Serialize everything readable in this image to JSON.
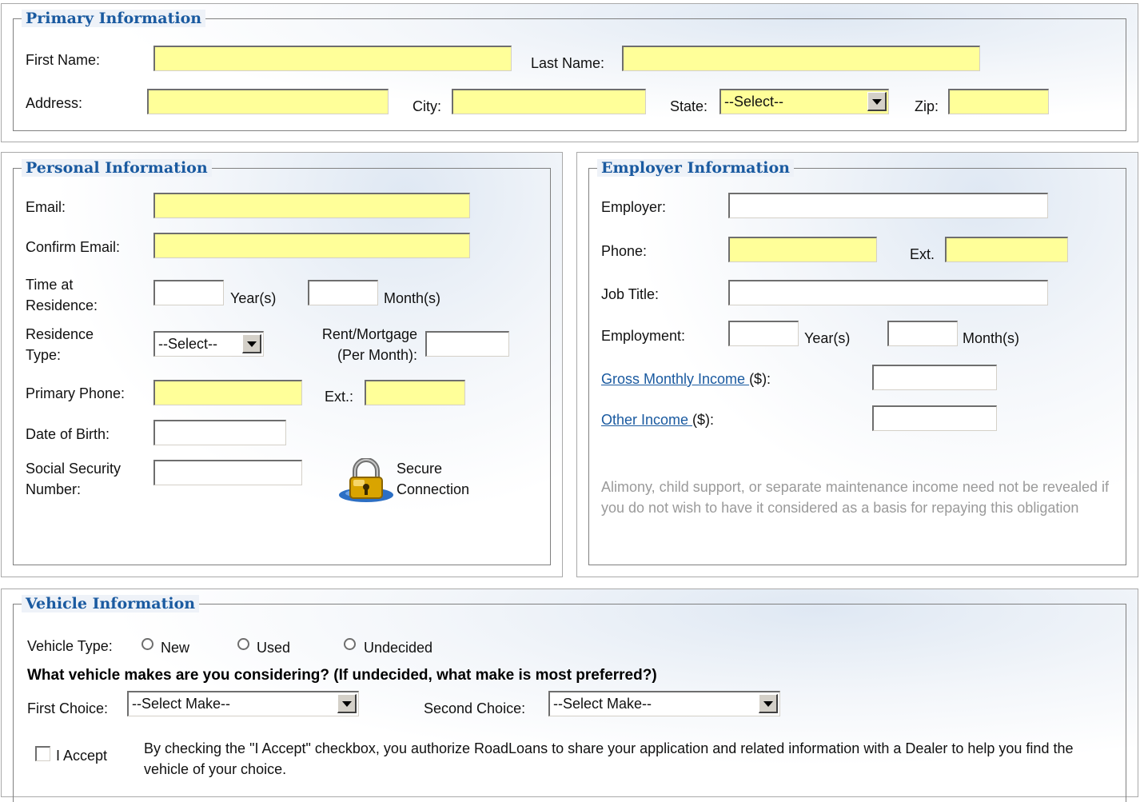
{
  "primary": {
    "legend": "Primary Information",
    "first_name_label": "First Name:",
    "last_name_label": "Last Name:",
    "address_label": "Address:",
    "city_label": "City:",
    "state_label": "State:",
    "state_value": "--Select--",
    "zip_label": "Zip:"
  },
  "personal": {
    "legend": "Personal Information",
    "email_label": "Email:",
    "confirm_email_label": "Confirm Email:",
    "time_at_residence_label_1": "Time at",
    "time_at_residence_label_2": "Residence:",
    "years_label": "Year(s)",
    "months_label": "Month(s)",
    "residence_type_label_1": "Residence",
    "residence_type_label_2": "Type:",
    "residence_type_value": "--Select--",
    "rent_label_1": "Rent/Mortgage",
    "rent_label_2": "(Per Month):",
    "primary_phone_label": "Primary Phone:",
    "ext_label": "Ext.:",
    "dob_label": "Date of Birth:",
    "ssn_label_1": "Social Security",
    "ssn_label_2": "Number:",
    "secure_label_1": "Secure",
    "secure_label_2": "Connection"
  },
  "employer": {
    "legend": "Employer Information",
    "employer_label": "Employer:",
    "phone_label": "Phone:",
    "ext_label": "Ext.",
    "job_title_label": "Job Title:",
    "employment_label": "Employment:",
    "years_label": "Year(s)",
    "months_label": "Month(s)",
    "gross_income_link": "Gross Monthly Income ",
    "gross_income_unit": "($):",
    "other_income_link": "Other Income ",
    "other_income_unit": "($):",
    "note": "Alimony, child support, or separate maintenance income need not be revealed if you do not wish to have it considered as a basis for repaying this obligation"
  },
  "vehicle": {
    "legend": "Vehicle Information",
    "type_label": "Vehicle Type:",
    "option_new": "New",
    "option_used": "Used",
    "option_undecided": "Undecided",
    "question": "What vehicle makes are you considering? (If undecided, what make is most preferred?)",
    "first_choice_label": "First Choice:",
    "first_choice_value": "--Select Make--",
    "second_choice_label": "Second Choice:",
    "second_choice_value": "--Select Make--",
    "accept_label": "I Accept",
    "accept_text": "By checking the \"I Accept\" checkbox, you authorize RoadLoans to share your application and related information with a Dealer to help you find the vehicle of your choice."
  },
  "colors": {
    "required_field": "#ffff99",
    "legend_text": "#1a5aa0",
    "link": "#1a5aa0",
    "note_text": "#9a9a9a"
  },
  "icons": {
    "secure": "padlock-icon"
  }
}
